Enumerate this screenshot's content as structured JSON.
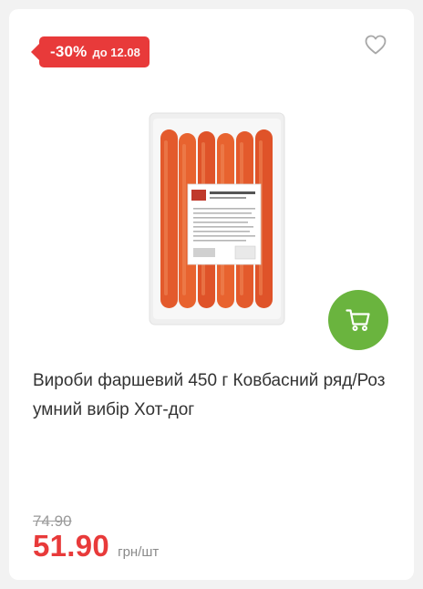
{
  "badge": {
    "discount": "-30%",
    "until": "до 12.08"
  },
  "product": {
    "title": "Вироби фаршевий 450 г Ковбасний ряд/Розумний вибір Хот-дог",
    "image": "hot-dog-sausages-pack"
  },
  "price": {
    "old": "74.90",
    "current": "51.90",
    "unit": "грн/шт"
  },
  "icons": {
    "favorite": "heart-outline-icon",
    "cart": "cart-icon"
  },
  "colors": {
    "accent": "#e83a3a",
    "cart_button": "#6ab43e",
    "text": "#333333",
    "muted": "#9a9a9a"
  }
}
